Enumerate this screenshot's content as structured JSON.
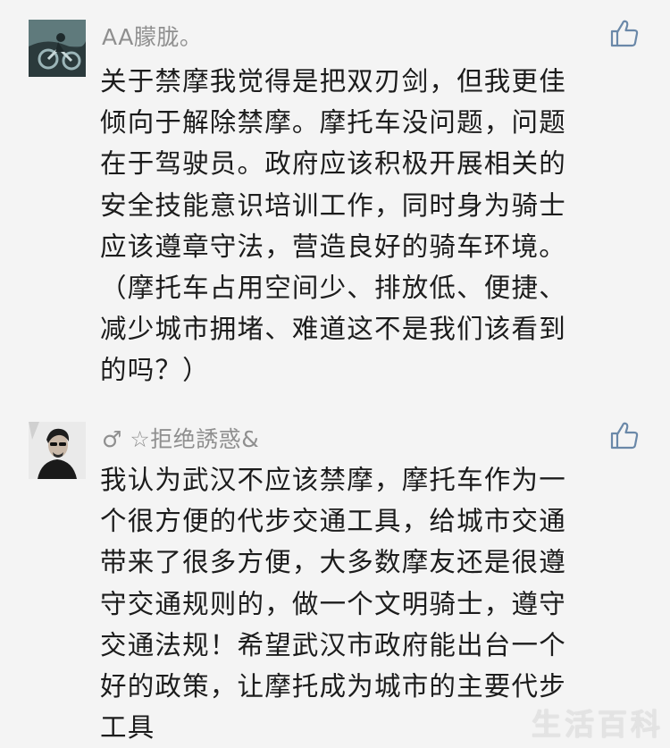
{
  "comments": [
    {
      "username": "AA朦胧。",
      "text": "关于禁摩我觉得是把双刃剑，但我更佳\n倾向于解除禁摩。摩托车没问题，问题\n在于驾驶员。政府应该积极开展相关的\n安全技能意识培训工作，同时身为骑士\n应该遵章守法，营造良好的骑车环境。\n（摩托车占用空间少、排放低、便捷、\n减少城市拥堵、难道这不是我们该看到\n的吗？）"
    },
    {
      "username": "♂ ☆拒绝誘惑&",
      "text": "我认为武汉不应该禁摩，摩托车作为一\n个很方便的代步交通工具，给城市交通\n带来了很多方便，大多数摩友还是很遵\n守交通规则的，做一个文明骑士，遵守\n交通法规！希望武汉市政府能出台一个\n好的政策，让摩托成为城市的主要代步\n工具"
    }
  ],
  "icons": {
    "like": "thumbs-up-outline-icon"
  },
  "watermark": "生活百科",
  "colors": {
    "background": "#f4f4f4",
    "username": "#8f8f8f",
    "text": "#1c1c1c",
    "like_icon": "#6a88a8"
  }
}
